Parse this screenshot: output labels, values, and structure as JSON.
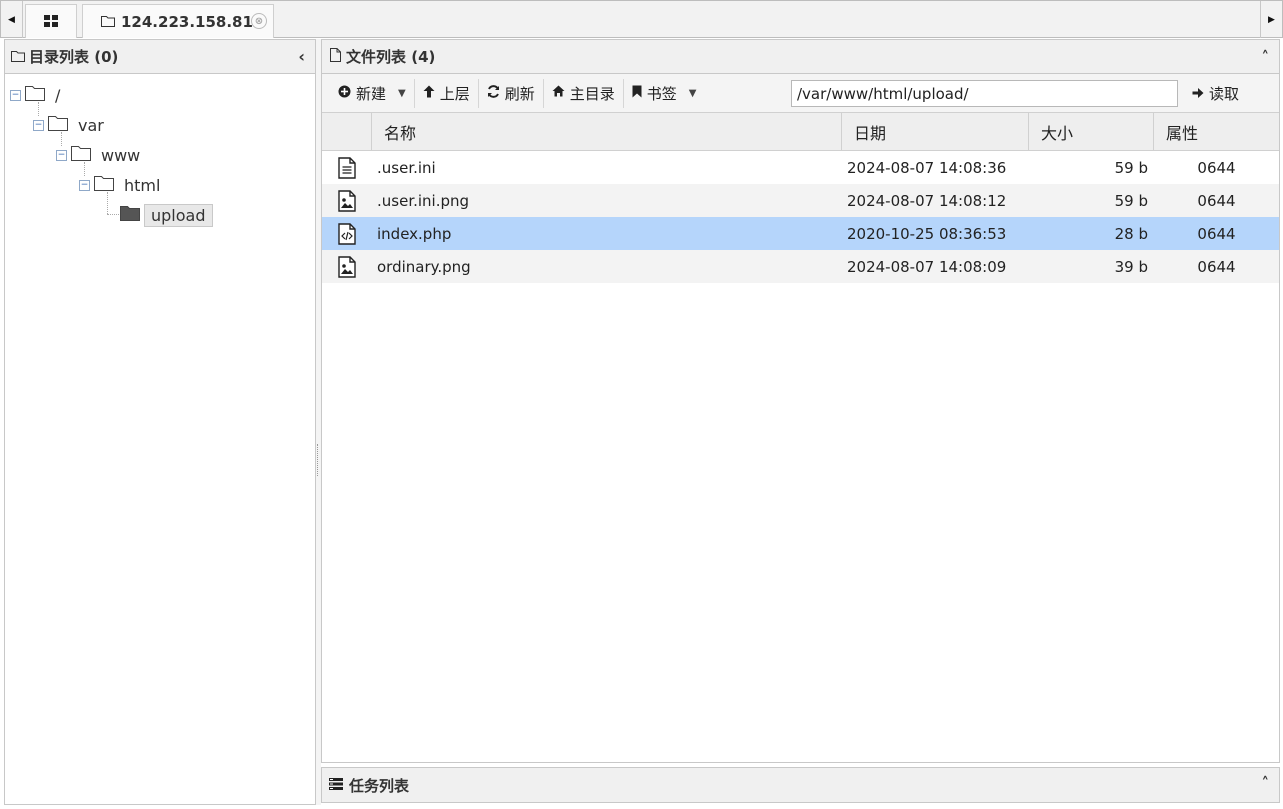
{
  "tabs": {
    "home_icon": "grid-icon",
    "host_tab": "124.223.158.81",
    "close_glyph": "⊗"
  },
  "left_panel": {
    "title": "目录列表 (0)",
    "tree": [
      {
        "label": "/",
        "depth": 0
      },
      {
        "label": "var",
        "depth": 1
      },
      {
        "label": "www",
        "depth": 2
      },
      {
        "label": "html",
        "depth": 3
      },
      {
        "label": "upload",
        "depth": 4,
        "selected": true
      }
    ]
  },
  "right_panel": {
    "title": "文件列表 (4)",
    "toolbar": {
      "new_label": "新建",
      "up_label": "上层",
      "refresh_label": "刷新",
      "home_label": "主目录",
      "bookmark_label": "书签",
      "path_value": "/var/www/html/upload/",
      "read_label": "读取"
    },
    "columns": {
      "name": "名称",
      "date": "日期",
      "size": "大小",
      "attr": "属性"
    },
    "files": [
      {
        "icon": "text-file-icon",
        "name": ".user.ini",
        "date": "2024-08-07 14:08:36",
        "size": "59 b",
        "attr": "0644"
      },
      {
        "icon": "image-file-icon",
        "name": ".user.ini.png",
        "date": "2024-08-07 14:08:12",
        "size": "59 b",
        "attr": "0644"
      },
      {
        "icon": "code-file-icon",
        "name": "index.php",
        "date": "2020-10-25 08:36:53",
        "size": "28 b",
        "attr": "0644",
        "selected": true
      },
      {
        "icon": "image-file-icon",
        "name": "ordinary.png",
        "date": "2024-08-07 14:08:09",
        "size": "39 b",
        "attr": "0644"
      }
    ]
  },
  "task_panel": {
    "title": "任务列表"
  },
  "colors": {
    "selected_row": "#b5d5fb",
    "panel_header": "#f0f0f0",
    "border": "#c8c8c8"
  }
}
